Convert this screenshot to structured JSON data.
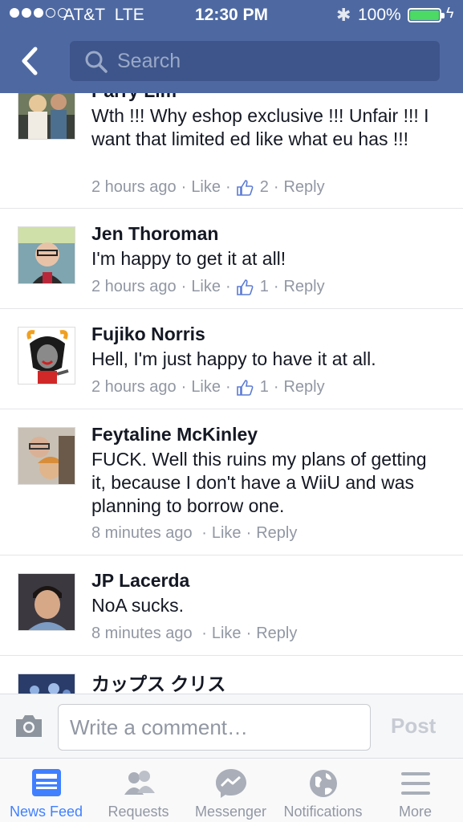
{
  "status_bar": {
    "carrier": "AT&T",
    "network": "LTE",
    "time": "12:30 PM",
    "battery": "100%",
    "signal_bars_filled": 3,
    "signal_bars_total": 5
  },
  "nav": {
    "search_placeholder": "Search"
  },
  "comments": [
    {
      "name": "Parry Lim",
      "text": "Wth !!! Why eshop exclusive !!! Unfair !!! I want that limited ed like what eu has !!!",
      "time": "2 hours ago",
      "like_label": "Like",
      "like_count": "2",
      "reply_label": "Reply"
    },
    {
      "name": "Jen Thoroman",
      "text": "I'm happy to get it at all!",
      "time": "2 hours ago",
      "like_label": "Like",
      "like_count": "1",
      "reply_label": "Reply"
    },
    {
      "name": "Fujiko Norris",
      "text": "Hell, I'm just happy to have it at all.",
      "time": "2 hours ago",
      "like_label": "Like",
      "like_count": "1",
      "reply_label": "Reply"
    },
    {
      "name": "Feytaline McKinley",
      "text": "FUCK. Well this ruins my plans of getting it, because I don't have a WiiU and was planning to borrow one.",
      "time": "8 minutes ago",
      "like_label": "Like",
      "reply_label": "Reply"
    },
    {
      "name": "JP Lacerda",
      "text": "NoA sucks.",
      "time": "8 minutes ago",
      "like_label": "Like",
      "reply_label": "Reply"
    },
    {
      "name": "カップス クリス"
    }
  ],
  "composer": {
    "placeholder": "Write a comment…",
    "post_label": "Post"
  },
  "tabs": [
    {
      "label": "News Feed",
      "icon": "news-feed-icon",
      "active": true
    },
    {
      "label": "Requests",
      "icon": "friends-icon",
      "active": false
    },
    {
      "label": "Messenger",
      "icon": "messenger-icon",
      "active": false
    },
    {
      "label": "Notifications",
      "icon": "globe-icon",
      "active": false
    },
    {
      "label": "More",
      "icon": "menu-icon",
      "active": false
    }
  ],
  "colors": {
    "brand": "#4e69a2",
    "active_tab": "#4080ff",
    "battery": "#4cd964",
    "muted_text": "#9197a3"
  }
}
